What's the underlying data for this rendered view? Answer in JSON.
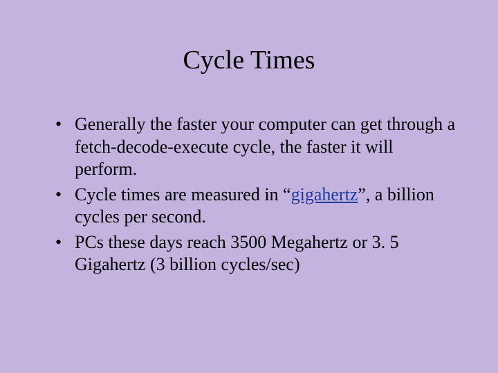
{
  "slide": {
    "title": "Cycle Times",
    "bullets": [
      {
        "text_before": "Generally the faster your computer can get through a fetch-decode-execute cycle, the faster it will perform.",
        "link": "",
        "text_after": ""
      },
      {
        "text_before": "Cycle times are measured in “",
        "link": "gigahertz",
        "text_after": "”, a billion cycles per second."
      },
      {
        "text_before": "PCs these days reach 3500 Megahertz or 3. 5 Gigahertz (3 billion cycles/sec)",
        "link": "",
        "text_after": ""
      }
    ]
  }
}
